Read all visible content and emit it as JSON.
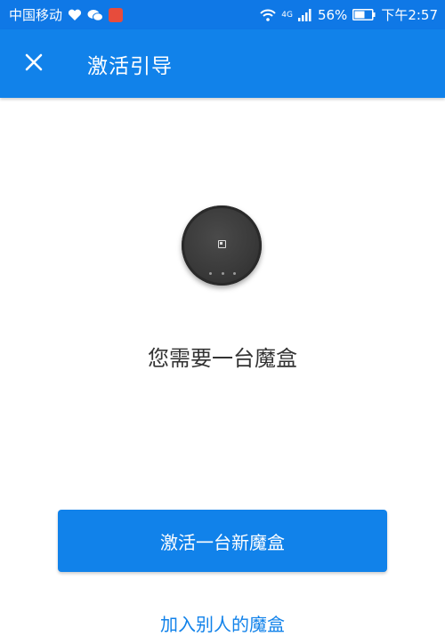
{
  "status_bar": {
    "carrier": "中国移动",
    "network": "4G",
    "battery": "56%",
    "time": "下午2:57"
  },
  "app_bar": {
    "title": "激活引导"
  },
  "main": {
    "message": "您需要一台魔盒",
    "primary_button_label": "激活一台新魔盒",
    "secondary_link_label": "加入别人的魔盒"
  },
  "colors": {
    "primary": "#1182ea",
    "status_bar": "#0f78e6"
  },
  "icons": [
    "heart-icon",
    "wechat-icon",
    "app-notification-icon",
    "wifi-icon",
    "signal-icon",
    "battery-icon",
    "close-icon"
  ]
}
